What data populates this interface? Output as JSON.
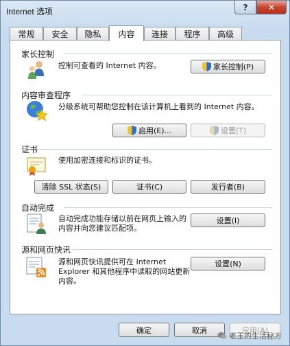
{
  "window": {
    "title": "Internet 选项",
    "help": "?",
    "close": "✕"
  },
  "tabs": [
    "常规",
    "安全",
    "隐私",
    "内容",
    "连接",
    "程序",
    "高级"
  ],
  "parental": {
    "title": "家长控制",
    "desc": "控制可查看的 Internet 内容。",
    "button": "家长控制(P)"
  },
  "advisor": {
    "title": "内容审查程序",
    "desc": "分级系统可帮助您控制在该计算机上看到的 Internet 内容。",
    "enable_button": "启用(E)...",
    "settings_button": "设置(T)"
  },
  "certificates": {
    "title": "证书",
    "desc": "使用加密连接和标识的证书。",
    "clear_ssl": "清除 SSL 状态(S)",
    "certs": "证书(C)",
    "publishers": "发行者(B)"
  },
  "autocomplete": {
    "title": "自动完成",
    "desc": "自动完成功能存储以前在网页上输入的内容并向您建议匹配项。",
    "button": "设置(I)"
  },
  "feeds": {
    "title": "源和网页快讯",
    "desc": "源和网页快讯提供可在 Internet Explorer 和其他程序中读取的网站更新内容。",
    "button": "设置(N)"
  },
  "footer": {
    "ok": "确定",
    "cancel": "取消",
    "apply": "应用(A)"
  },
  "watermark": "老王的生活秘方"
}
